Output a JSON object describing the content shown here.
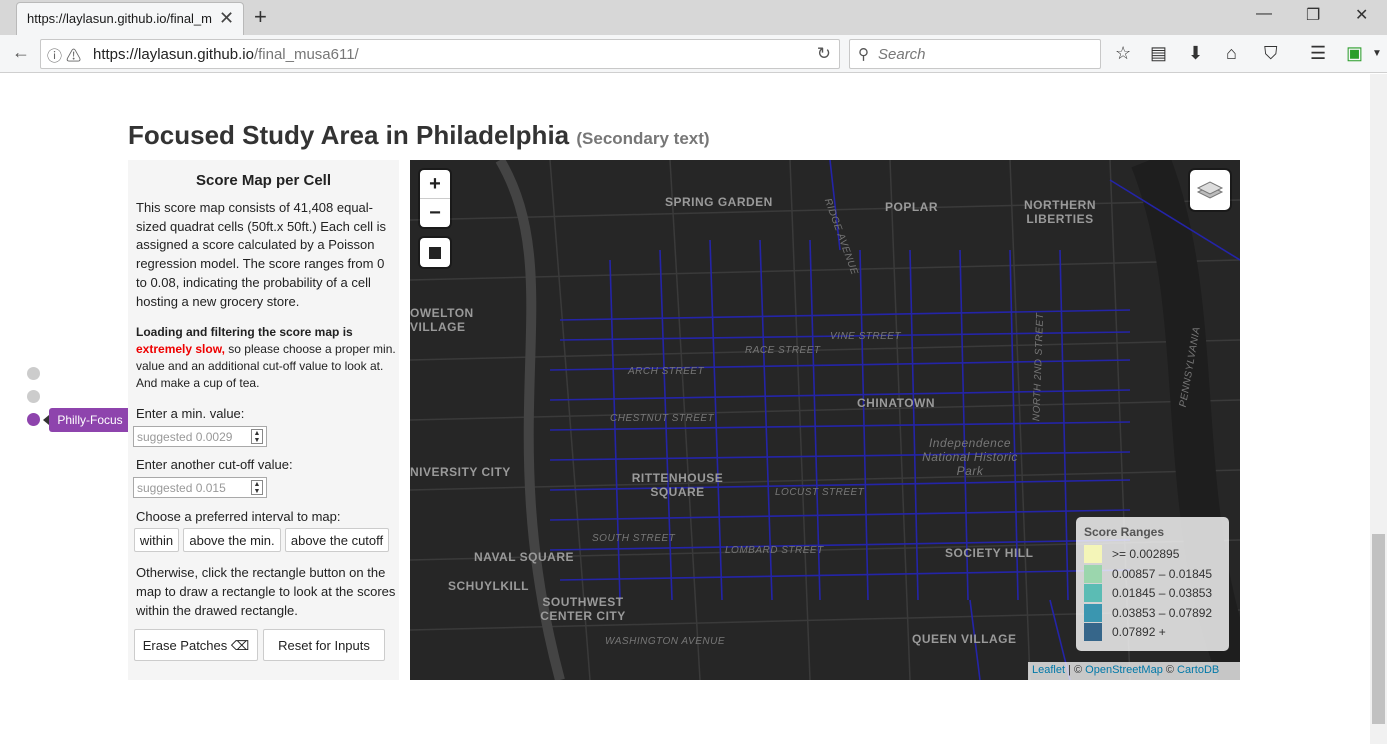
{
  "browser": {
    "tab_title": "https://laylasun.github.io/final_m",
    "url_domain": "https://laylasun.github.io",
    "url_path": "/final_musa611/",
    "search_placeholder": "Search"
  },
  "page": {
    "title": "Focused Study Area in Philadelphia",
    "subtitle": "(Secondary text)"
  },
  "panel": {
    "heading": "Score Map per Cell",
    "description": "This score map consists of 41,408 equal-sized quadrat cells (50ft.x 50ft.) Each cell is assigned a score calculated by a Poisson regression model. The score ranges from 0 to 0.08, indicating the probability of a cell hosting a new grocery store.",
    "warning_bold": "Loading and filtering the score map is",
    "warning_red": "extremely slow,",
    "warning_rest": "so please choose a proper min. value and an additional cut-off value to look at. And make a cup of tea.",
    "min_label": "Enter a min. value:",
    "min_placeholder": "suggested 0.0029",
    "cutoff_label": "Enter another cut-off value:",
    "cutoff_placeholder": "suggested 0.015",
    "interval_label": "Choose a preferred interval to map:",
    "interval_buttons": [
      "within",
      "above the min.",
      "above the cutoff"
    ],
    "note": "Otherwise, click the rectangle button on the map to draw a rectangle to look at the scores within the drawed rectangle.",
    "erase_label": "Erase Patches",
    "reset_label": "Reset for Inputs"
  },
  "scroll_nav": {
    "active_tooltip": "Philly-Focus"
  },
  "map": {
    "labels": [
      "SPRING GARDEN",
      "POPLAR",
      "NORTHERN LIBERTIES",
      "OWELTON VILLAGE",
      "CHINATOWN",
      "Independence National Historic Park",
      "NIVERSITY CITY",
      "RITTENHOUSE SQUARE",
      "NAVAL SQUARE",
      "SCHUYLKILL",
      "SOUTHWEST CENTER CITY",
      "SOCIETY HILL",
      "QUEEN VILLAGE",
      "RACE STREET",
      "VINE STREET",
      "ARCH STREET",
      "CHESTNUT STREET",
      "LOCUST STREET",
      "SOUTH STREET",
      "LOMBARD STREET",
      "WASHINGTON AVENUE",
      "PENNSYLVANIA",
      "NORTH 2ND STREET",
      "RIDGE AVENUE"
    ],
    "zoom_in": "+",
    "zoom_out": "−",
    "legend": {
      "title": "Score Ranges",
      "items": [
        {
          "label": ">= 0.002895",
          "color": "#f4f5b8"
        },
        {
          "label": "0.00857 – 0.01845",
          "color": "#9bd6ad"
        },
        {
          "label": "0.01845 – 0.03853",
          "color": "#5bbcb4"
        },
        {
          "label": "0.03853 – 0.07892",
          "color": "#3a96b0"
        },
        {
          "label": "0.07892 +",
          "color": "#36668a"
        }
      ]
    },
    "attribution": {
      "leaflet": "Leaflet",
      "sep1": " | © ",
      "osm": "OpenStreetMap",
      "sep2": " © ",
      "carto": "CartoDB"
    }
  }
}
